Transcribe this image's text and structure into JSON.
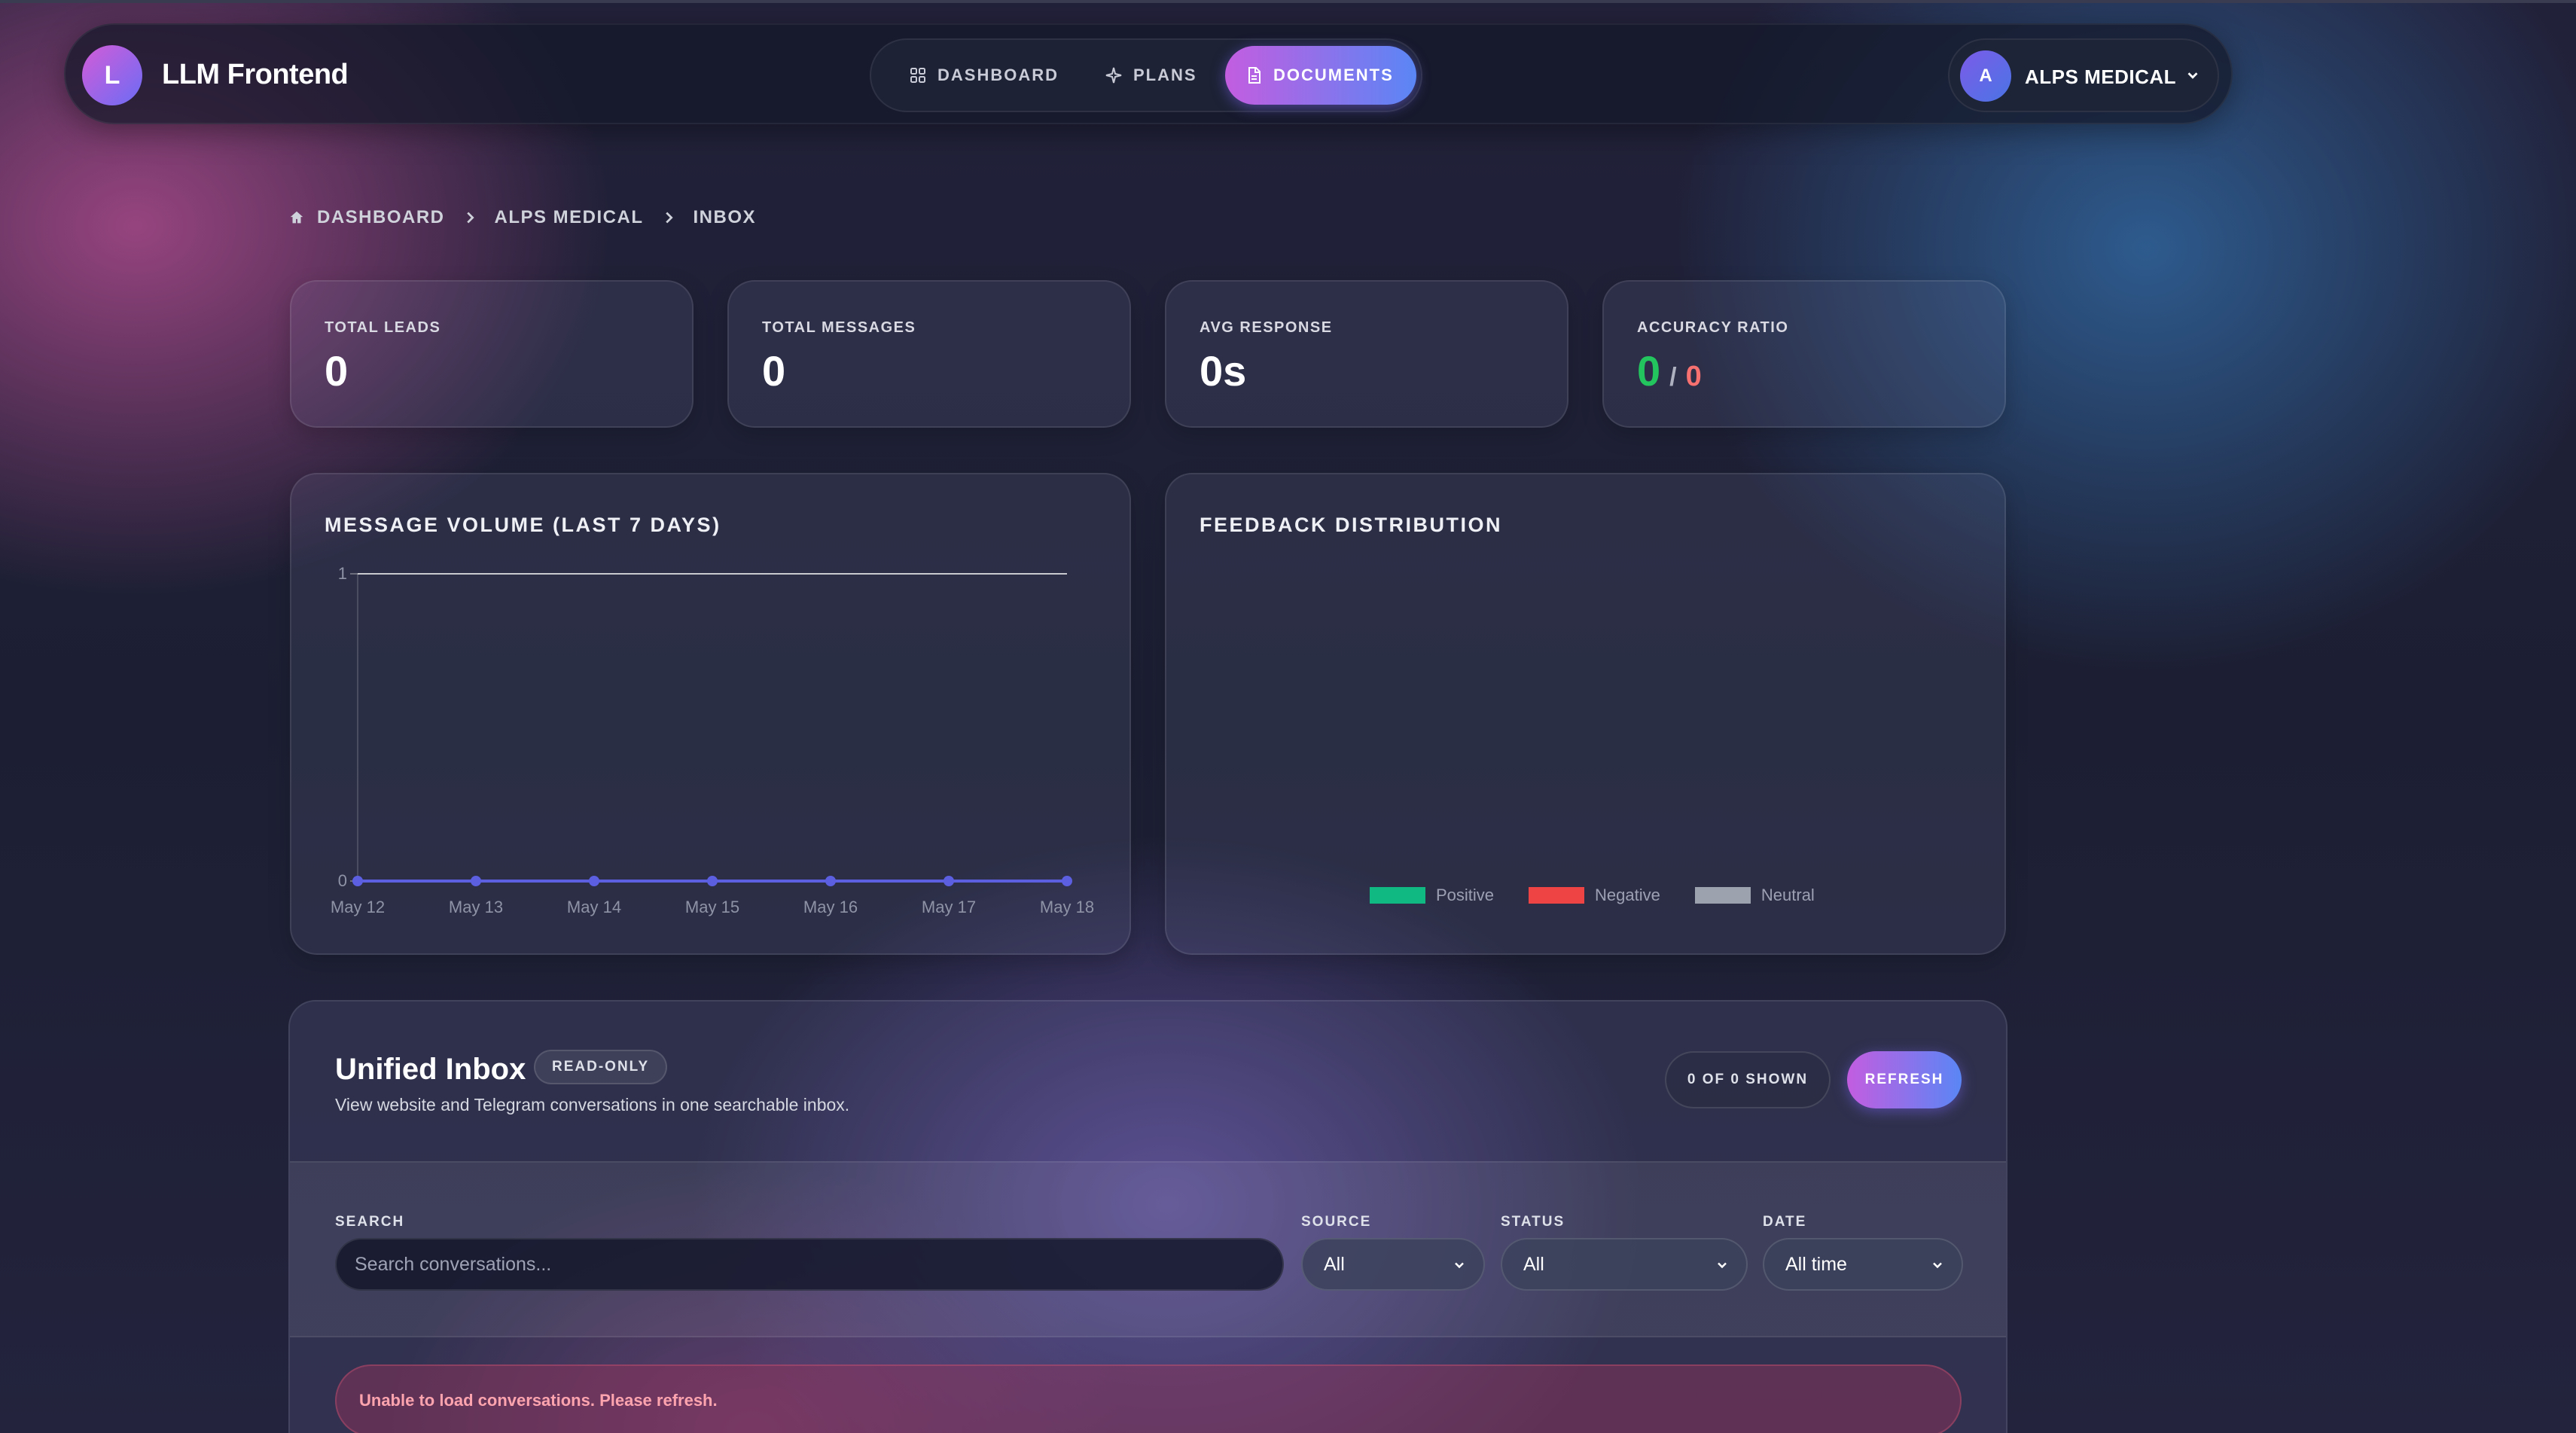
{
  "app": {
    "logo_letter": "L",
    "title": "LLM Frontend"
  },
  "nav": {
    "items": [
      {
        "label": "DASHBOARD",
        "icon": "grid-icon",
        "active": false
      },
      {
        "label": "PLANS",
        "icon": "sparkle-icon",
        "active": false
      },
      {
        "label": "DOCUMENTS",
        "icon": "document-icon",
        "active": true
      }
    ]
  },
  "account": {
    "avatar_letter": "A",
    "name": "ALPS MEDICAL",
    "icon": "chevron-down-icon"
  },
  "breadcrumb": {
    "items": [
      "DASHBOARD",
      "ALPS MEDICAL",
      "INBOX"
    ],
    "home_icon": "home-icon",
    "separator_icon": "chevron-right-icon"
  },
  "stats": {
    "total_leads": {
      "label": "TOTAL LEADS",
      "value": "0"
    },
    "total_messages": {
      "label": "TOTAL MESSAGES",
      "value": "0"
    },
    "avg_response": {
      "label": "AVG RESPONSE",
      "value": "0s"
    },
    "accuracy": {
      "label": "ACCURACY RATIO",
      "positive": "0",
      "separator": "/",
      "negative": "0"
    }
  },
  "message_volume": {
    "title": "MESSAGE VOLUME (LAST 7 DAYS)"
  },
  "feedback": {
    "title": "FEEDBACK DISTRIBUTION",
    "legend": [
      {
        "label": "Positive",
        "color": "#10b981"
      },
      {
        "label": "Negative",
        "color": "#ef4444"
      },
      {
        "label": "Neutral",
        "color": "#9ca3af"
      }
    ]
  },
  "chart_data": {
    "type": "line",
    "title": "MESSAGE VOLUME (LAST 7 DAYS)",
    "categories": [
      "May 12",
      "May 13",
      "May 14",
      "May 15",
      "May 16",
      "May 17",
      "May 18"
    ],
    "series": [
      {
        "values": [
          0,
          0,
          0,
          0,
          0,
          0,
          0
        ],
        "color": "#5b5fe0"
      }
    ],
    "ylim": [
      0,
      1
    ],
    "yticks": [
      "0",
      "1"
    ],
    "xlabel": "",
    "ylabel": "",
    "grid": false
  },
  "inbox": {
    "title": "Unified Inbox",
    "badge": "READ-ONLY",
    "subtitle": "View website and Telegram conversations in one searchable inbox.",
    "shown": "0 OF 0 SHOWN",
    "refresh_label": "REFRESH",
    "search_label": "SEARCH",
    "search_placeholder": "Search conversations...",
    "source_label": "SOURCE",
    "source_value": "All",
    "status_label": "STATUS",
    "status_value": "All",
    "date_label": "DATE",
    "date_value": "All time",
    "error": "Unable to load conversations. Please refresh."
  }
}
